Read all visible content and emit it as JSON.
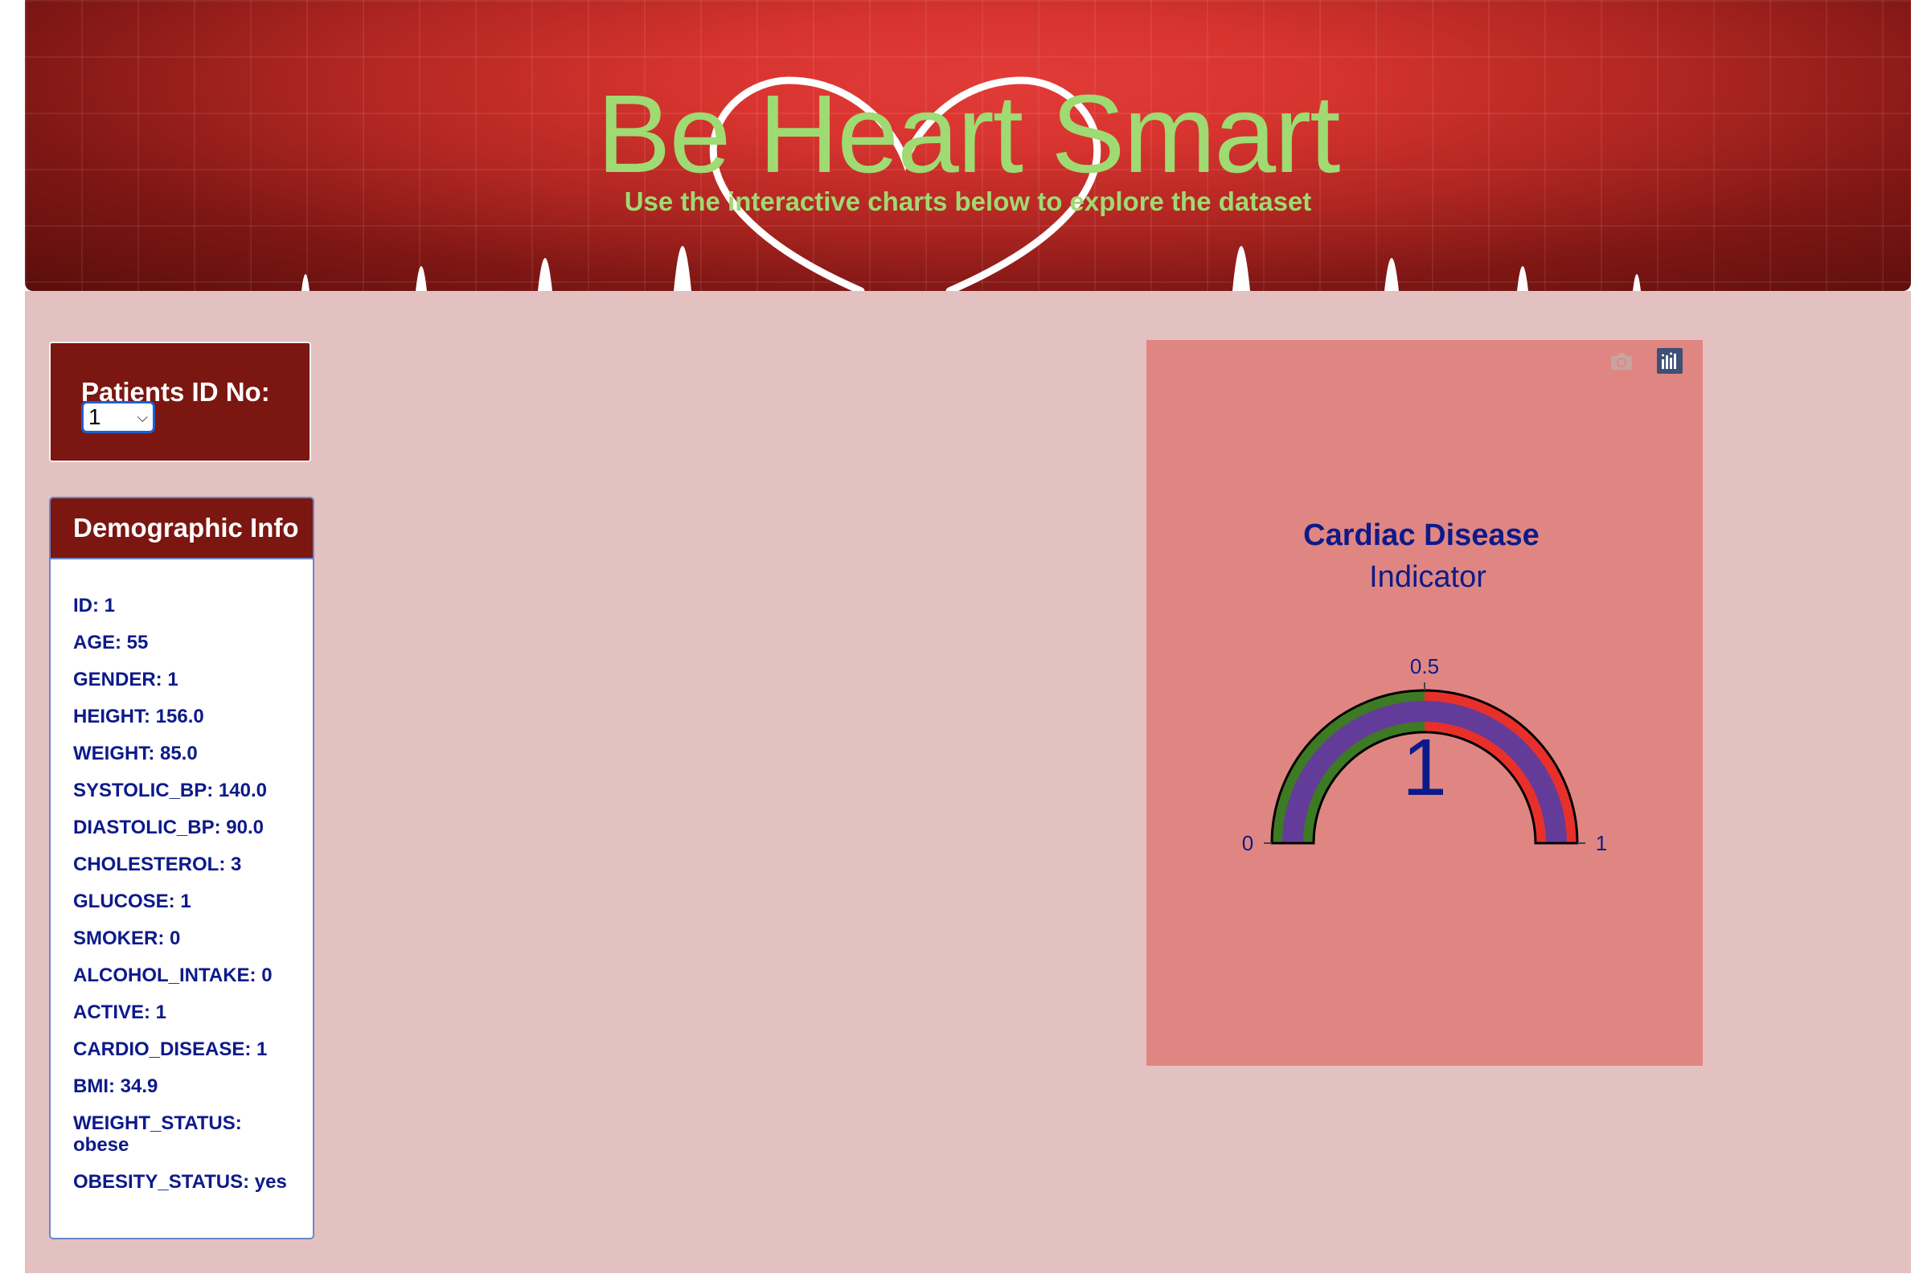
{
  "header": {
    "title": "Be Heart Smart",
    "subtitle": "Use the interactive charts below to explore the dataset"
  },
  "patient_select": {
    "label": "Patients ID No:",
    "selected": "1"
  },
  "demographic": {
    "title": "Demographic Info",
    "items": [
      {
        "text": "ID: 1"
      },
      {
        "text": "AGE: 55"
      },
      {
        "text": "GENDER: 1"
      },
      {
        "text": "HEIGHT: 156.0"
      },
      {
        "text": "WEIGHT: 85.0"
      },
      {
        "text": "SYSTOLIC_BP: 140.0"
      },
      {
        "text": "DIASTOLIC_BP: 90.0"
      },
      {
        "text": "CHOLESTEROL: 3"
      },
      {
        "text": "GLUCOSE: 1"
      },
      {
        "text": "SMOKER: 0"
      },
      {
        "text": "ALCOHOL_INTAKE: 0"
      },
      {
        "text": "ACTIVE: 1"
      },
      {
        "text": "CARDIO_DISEASE: 1"
      },
      {
        "text": "BMI: 34.9"
      },
      {
        "text": "WEIGHT_STATUS: obese"
      },
      {
        "text": "OBESITY_STATUS: yes"
      }
    ]
  },
  "gauge": {
    "title_line1": "Cardiac Disease",
    "title_line2": "Indicator",
    "value": 1,
    "value_label": "1",
    "range": [
      0,
      1
    ],
    "tick_labels": [
      "0",
      "0.5",
      "1"
    ],
    "steps": [
      {
        "range": [
          0,
          0.5
        ],
        "color": "#3d7a23"
      },
      {
        "range": [
          0.5,
          1
        ],
        "color": "#e8302b"
      }
    ],
    "bar_color": "#633c99",
    "text_color": "#0d1a8a",
    "modebar": [
      "camera-icon",
      "plotly-logo-icon"
    ]
  },
  "colors": {
    "accent_green": "#9fda72",
    "dark_red": "#7c1611",
    "page_bg": "#e4c1c1",
    "navy_text": "#0d1a8a"
  }
}
